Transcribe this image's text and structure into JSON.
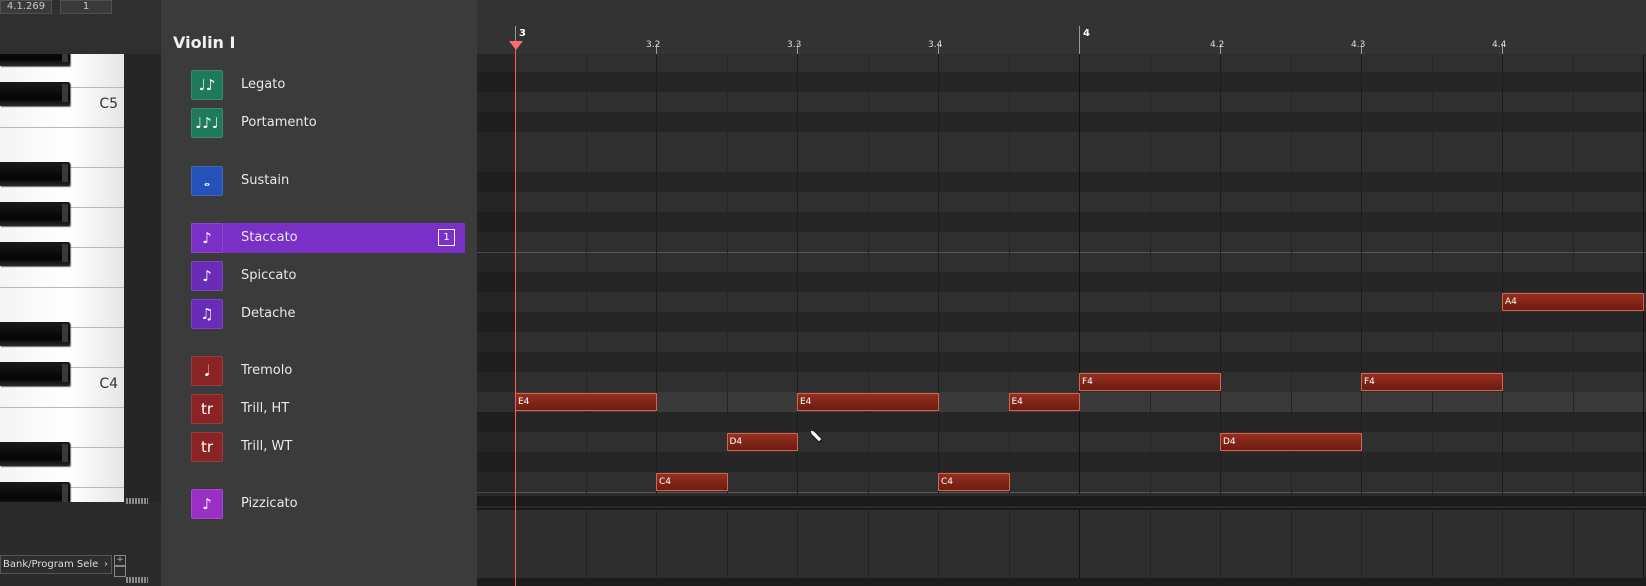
{
  "counters": [
    "4.1.269",
    "1"
  ],
  "keyboard": {
    "labels": [
      {
        "text": "C5",
        "key": 3
      },
      {
        "text": "C4",
        "key": 10
      }
    ]
  },
  "articulations": {
    "title": "Violin I",
    "items": [
      {
        "name": "legato",
        "label": "Legato",
        "color": "#1e7a5a",
        "icon": "legato-icon",
        "glyph": "♩♪",
        "selected": false,
        "badge": ""
      },
      {
        "name": "portamento",
        "label": "Portamento",
        "color": "#1e7a5a",
        "icon": "portamento-icon",
        "glyph": "♩♪♩",
        "selected": false,
        "badge": ""
      },
      {
        "name": "sustain",
        "label": "Sustain",
        "color": "#2452b8",
        "icon": "whole-note-icon",
        "glyph": "𝅝",
        "selected": false,
        "badge": ""
      },
      {
        "name": "staccato",
        "label": "Staccato",
        "color": "#7a2fc7",
        "icon": "staccato-icon",
        "glyph": "♪",
        "selected": true,
        "badge": "1"
      },
      {
        "name": "spiccato",
        "label": "Spiccato",
        "color": "#6a2bb8",
        "icon": "spiccato-icon",
        "glyph": "♪",
        "selected": false,
        "badge": ""
      },
      {
        "name": "detache",
        "label": "Detache",
        "color": "#6a2bb8",
        "icon": "detache-icon",
        "glyph": "♫",
        "selected": false,
        "badge": ""
      },
      {
        "name": "tremolo",
        "label": "Tremolo",
        "color": "#8a2323",
        "icon": "tremolo-icon",
        "glyph": "𝅘𝅥",
        "selected": false,
        "badge": ""
      },
      {
        "name": "trill-ht",
        "label": "Trill, HT",
        "color": "#8a2323",
        "icon": "trill-half-tone-icon",
        "glyph": "tr",
        "selected": false,
        "badge": ""
      },
      {
        "name": "trill-wt",
        "label": "Trill, WT",
        "color": "#8a2323",
        "icon": "trill-whole-tone-icon",
        "glyph": "tr",
        "selected": false,
        "badge": ""
      },
      {
        "name": "pizzicato",
        "label": "Pizzicato",
        "color": "#9a2fc7",
        "icon": "pizzicato-icon",
        "glyph": "♪",
        "selected": false,
        "badge": ""
      }
    ]
  },
  "ruler": {
    "labels": [
      {
        "text": "3",
        "pos": 3.0,
        "bar": true
      },
      {
        "text": "3.2",
        "pos": 3.25,
        "bar": false
      },
      {
        "text": "3.3",
        "pos": 3.5,
        "bar": false
      },
      {
        "text": "3.4",
        "pos": 3.75,
        "bar": false
      },
      {
        "text": "4",
        "pos": 4.0,
        "bar": true
      },
      {
        "text": "4.2",
        "pos": 4.25,
        "bar": false
      },
      {
        "text": "4.3",
        "pos": 4.5,
        "bar": false
      },
      {
        "text": "4.4",
        "pos": 4.75,
        "bar": false
      }
    ]
  },
  "notes": [
    {
      "pitch": "E4",
      "start": 3.0,
      "length": 0.25
    },
    {
      "pitch": "C4",
      "start": 3.25,
      "length": 0.125
    },
    {
      "pitch": "D4",
      "start": 3.375,
      "length": 0.125
    },
    {
      "pitch": "E4",
      "start": 3.5,
      "length": 0.25
    },
    {
      "pitch": "C4",
      "start": 3.75,
      "length": 0.125
    },
    {
      "pitch": "E4",
      "start": 3.875,
      "length": 0.125
    },
    {
      "pitch": "F4",
      "start": 4.0,
      "length": 0.25
    },
    {
      "pitch": "D4",
      "start": 4.25,
      "length": 0.25
    },
    {
      "pitch": "F4",
      "start": 4.5,
      "length": 0.25
    },
    {
      "pitch": "A4",
      "start": 4.75,
      "length": 0.25
    }
  ],
  "bank_program": "Bank/Program Sele",
  "colors": {
    "note_fill": "#962e1e",
    "playhead": "#ff5a5a",
    "selected_articulation": "#7a2fc7"
  }
}
